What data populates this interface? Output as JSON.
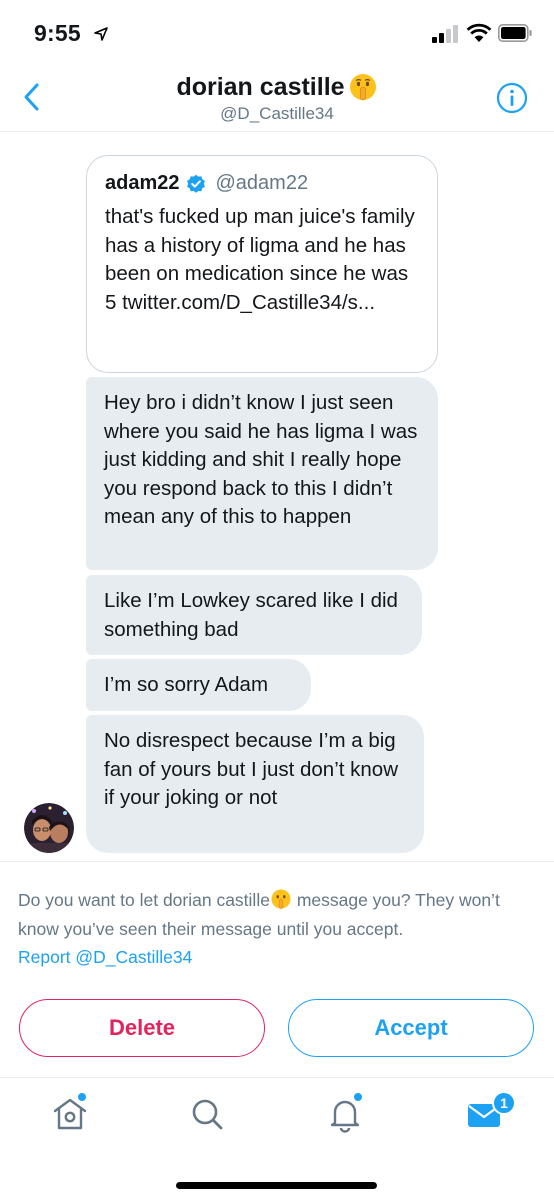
{
  "status_bar": {
    "time": "9:55"
  },
  "header": {
    "name": "dorian castille",
    "handle": "@D_Castille34"
  },
  "quote": {
    "name": "adam22",
    "handle": "@adam22",
    "text": "that's fucked up man juice's family has a history of ligma and he has been on medication since he was 5 twitter.com/D_Castille34/s..."
  },
  "messages": [
    "Hey bro i didn’t know I just seen where you said he has ligma I was just kidding and shit I really hope you respond back to this I didn’t mean any of this to happen",
    "Like I’m Lowkey scared like I did something bad",
    "I’m so sorry Adam",
    "No disrespect because I’m a big fan of yours but I just don’t know if your joking or not"
  ],
  "request": {
    "prefix": "Do you want to let dorian castille",
    "suffix": " message you? They won’t know you’ve seen their message until you accept.",
    "report_link": "Report @D_Castille34"
  },
  "buttons": {
    "delete": "Delete",
    "accept": "Accept"
  },
  "tab_bar": {
    "messages_badge": "1"
  },
  "colors": {
    "accent": "#1da1f2",
    "danger": "#e0245e",
    "bubble": "#e6ecf0",
    "muted": "#657786"
  },
  "icons": [
    "location-arrow-icon",
    "signal-icon",
    "wifi-icon",
    "battery-icon",
    "back-chevron-icon",
    "info-icon",
    "shushing-face-emoji",
    "verified-badge-icon",
    "home-icon",
    "search-icon",
    "notifications-bell-icon",
    "messages-envelope-icon"
  ]
}
